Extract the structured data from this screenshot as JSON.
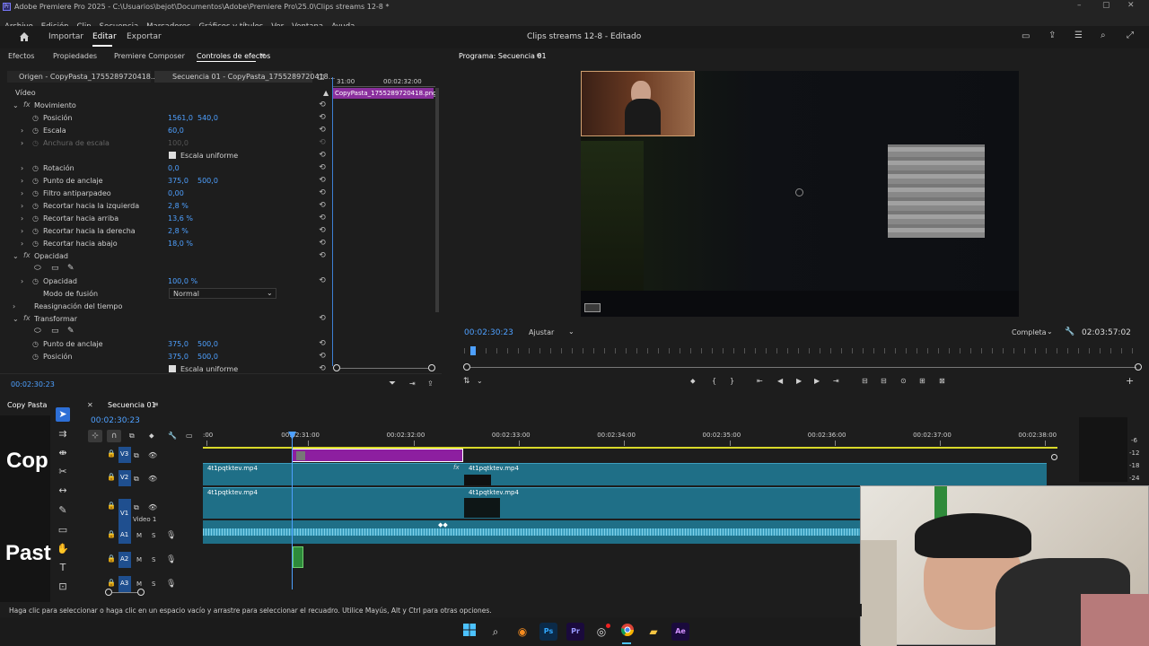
{
  "window": {
    "title": "Adobe Premiere Pro 2025 - C:\\Usuarios\\bejot\\Documentos\\Adobe\\Premiere Pro\\25.0\\Clips streams 12-8 *"
  },
  "menu": [
    "Archivo",
    "Edición",
    "Clip",
    "Secuencia",
    "Marcadores",
    "Gráficos y títulos",
    "Ver",
    "Ventana",
    "Ayuda"
  ],
  "appbar": {
    "home_icon": "home-icon",
    "tabs": [
      "Importar",
      "Editar",
      "Exportar"
    ],
    "active_tab": "Editar",
    "project_title": "Clips streams 12-8 - Editado"
  },
  "left_tabs": [
    "Efectos",
    "Propiedades",
    "Premiere Composer",
    "Controles de efectos"
  ],
  "source_tabs": {
    "origin": "Origen - CopyPasta_1755289720418...",
    "sequence": "Secuencia 01 - CopyPasta_1755289720418..."
  },
  "mini_timeline": {
    "t1": "31:00",
    "t2": "00:02:32:00",
    "clip": "CopyPasta_1755289720418.png"
  },
  "effects": {
    "video_header": "Vídeo",
    "movimiento": "Movimiento",
    "rows": [
      {
        "label": "Posición",
        "v1": "1561,0",
        "v2": "540,0"
      },
      {
        "label": "Escala",
        "v1": "60,0",
        "v2": ""
      },
      {
        "label": "Anchura de escala",
        "v1": "100,0",
        "v2": ""
      },
      {
        "label": "Escala uniforme",
        "v1": "",
        "v2": ""
      },
      {
        "label": "Rotación",
        "v1": "0,0",
        "v2": ""
      },
      {
        "label": "Punto de anclaje",
        "v1": "375,0",
        "v2": "500,0"
      },
      {
        "label": "Filtro antiparpadeo",
        "v1": "0,00",
        "v2": ""
      },
      {
        "label": "Recortar hacia la izquierda",
        "v1": "2,8 %",
        "v2": ""
      },
      {
        "label": "Recortar hacia arriba",
        "v1": "13,6 %",
        "v2": ""
      },
      {
        "label": "Recortar hacia la derecha",
        "v1": "2,8 %",
        "v2": ""
      },
      {
        "label": "Recortar hacia abajo",
        "v1": "18,0 %",
        "v2": ""
      }
    ],
    "opacidad": "Opacidad",
    "opacidad_row": {
      "label": "Opacidad",
      "v1": "100,0 %"
    },
    "modo_fusion": {
      "label": "Modo de fusión",
      "value": "Normal"
    },
    "reasignacion": "Reasignación del tiempo",
    "transformar": "Transformar",
    "t_rows": [
      {
        "label": "Punto de anclaje",
        "v1": "375,0",
        "v2": "500,0"
      },
      {
        "label": "Posición",
        "v1": "375,0",
        "v2": "500,0"
      },
      {
        "label": "Escala uniforme",
        "v1": "",
        "v2": ""
      }
    ],
    "timecode": "00:02:30:23"
  },
  "program": {
    "title": "Programa: Secuencia 01",
    "timecode": "00:02:30:23",
    "fit": "Ajustar",
    "quality": "Completa",
    "duration": "02:03:57:02"
  },
  "bottom_left": {
    "title": "Copy Pasta",
    "big1": "Cop",
    "big2": "Past"
  },
  "timeline": {
    "sequence": "Secuencia 01",
    "timecode": "00:02:30:23",
    "ruler": [
      ":00",
      "00:02:31:00",
      "00:02:32:00",
      "00:02:33:00",
      "00:02:34:00",
      "00:02:35:00",
      "00:02:36:00",
      "00:02:37:00",
      "00:02:38:00"
    ],
    "tracks": [
      {
        "id": "V3",
        "label": "V3"
      },
      {
        "id": "V2",
        "label": "V2"
      },
      {
        "id": "V1",
        "label": "V1",
        "name": "Video 1"
      },
      {
        "id": "A1",
        "label": "A1"
      },
      {
        "id": "A2",
        "label": "A2"
      },
      {
        "id": "A3",
        "label": "A3"
      }
    ],
    "clip_name": "4t1pqtktev.mp4",
    "track_ms": [
      "M",
      "S"
    ],
    "meter": [
      "-6",
      "-12",
      "-18",
      "-24"
    ]
  },
  "status": {
    "text": "Haga clic para seleccionar o haga clic en un espacio vacío y arrastre para seleccionar el recuadro. Utilice Mayús, Alt y Ctrl para otras opciones."
  },
  "taskbar": {
    "icons": [
      "windows-icon",
      "search-icon",
      "blender-icon",
      "photoshop-icon",
      "premiere-icon",
      "obs-icon",
      "chrome-icon",
      "folder-icon",
      "after-effects-icon"
    ],
    "labels": [
      "Ps",
      "Pr",
      "Ae"
    ]
  }
}
